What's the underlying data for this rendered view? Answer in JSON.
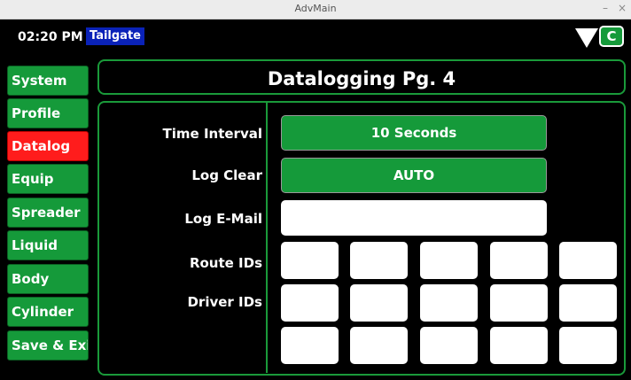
{
  "window": {
    "title": "AdvMain",
    "minimize": "–",
    "close": "×"
  },
  "header": {
    "time": "02:20 PM",
    "mode": "Tailgate",
    "badge": "C"
  },
  "sidebar": {
    "items": [
      {
        "label": "System"
      },
      {
        "label": "Profile"
      },
      {
        "label": "Datalog",
        "active": true
      },
      {
        "label": "Equip"
      },
      {
        "label": "Spreader"
      },
      {
        "label": "Liquid"
      },
      {
        "label": "Body"
      },
      {
        "label": "Cylinder"
      },
      {
        "label": "Save & Exit"
      }
    ]
  },
  "page": {
    "title": "Datalogging Pg. 4",
    "labels": {
      "time_interval": "Time Interval",
      "log_clear": "Log Clear",
      "log_email": "Log E-Mail",
      "route_ids": "Route IDs",
      "driver_ids": "Driver IDs"
    },
    "time_interval_value": "10 Seconds",
    "log_clear_value": "AUTO",
    "log_email_value": "",
    "route_ids": [
      "",
      "",
      "",
      "",
      ""
    ],
    "driver_ids_row1": [
      "",
      "",
      "",
      "",
      ""
    ],
    "driver_ids_row2": [
      "",
      "",
      "",
      "",
      ""
    ]
  },
  "colors": {
    "accent_green": "#159a3a",
    "active_red": "#ff1c1c",
    "mode_blue": "#0a22b8"
  }
}
